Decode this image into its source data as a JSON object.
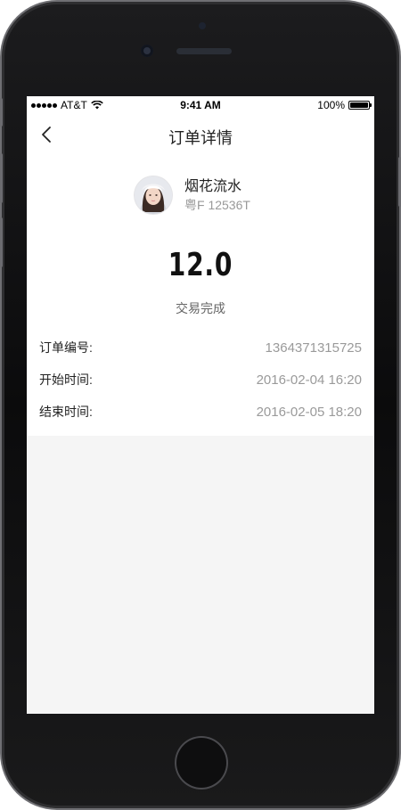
{
  "status_bar": {
    "carrier": "AT&T",
    "time": "9:41 AM",
    "battery": "100%",
    "signal_icon": "signal-dots-icon",
    "wifi_icon": "wifi-icon",
    "battery_icon": "battery-icon"
  },
  "nav": {
    "title": "订单详情",
    "back_icon": "chevron-left-icon"
  },
  "driver": {
    "name": "烟花流水",
    "plate": "粤F 12536T"
  },
  "order": {
    "amount": "12.0",
    "status": "交易完成",
    "fields": [
      {
        "label": "订单编号:",
        "value": "1364371315725"
      },
      {
        "label": "开始时间:",
        "value": "2016-02-04   16:20"
      },
      {
        "label": "结束时间:",
        "value": "2016-02-05   18:20"
      }
    ]
  }
}
